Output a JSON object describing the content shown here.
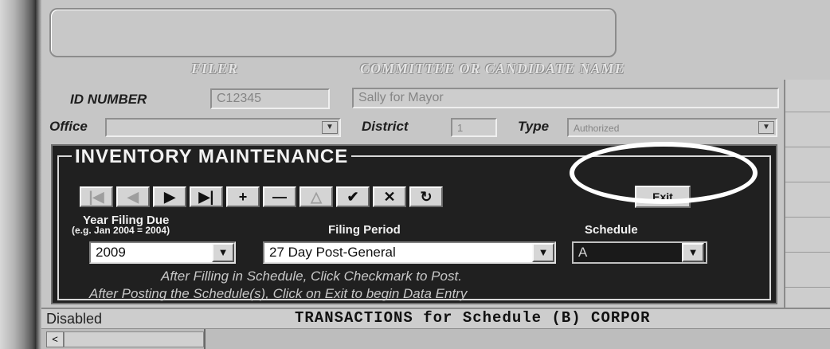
{
  "header": {
    "filer": "FILER",
    "committee_name_label": "COMMITTEE OR CANDIDATE NAME"
  },
  "form": {
    "id_number_label": "ID NUMBER",
    "id_number_value": "C12345",
    "committee_name_value": "Sally for Mayor",
    "office_label": "Office",
    "office_value": "",
    "district_label": "District",
    "district_value": "1",
    "type_label": "Type",
    "type_value": "Authorized"
  },
  "panel": {
    "title": "INVENTORY MAINTENANCE",
    "nav_buttons": [
      {
        "name": "first-record",
        "glyph": "|◀",
        "enabled": false
      },
      {
        "name": "previous-record",
        "glyph": "◀",
        "enabled": false
      },
      {
        "name": "next-record",
        "glyph": "▶",
        "enabled": true
      },
      {
        "name": "last-record",
        "glyph": "▶|",
        "enabled": true
      },
      {
        "name": "add-record",
        "glyph": "+",
        "enabled": true
      },
      {
        "name": "delete-record",
        "glyph": "—",
        "enabled": true
      },
      {
        "name": "edit-record",
        "glyph": "△",
        "enabled": false
      },
      {
        "name": "post-checkmark",
        "glyph": "✔",
        "enabled": true
      },
      {
        "name": "cancel",
        "glyph": "✕",
        "enabled": true
      },
      {
        "name": "refresh",
        "glyph": "↻",
        "enabled": true
      }
    ],
    "exit_label": "Exit",
    "year_label": "Year Filing Due",
    "year_hint": "(e.g. Jan 2004 = 2004)",
    "filing_period_label": "Filing Period",
    "schedule_label": "Schedule",
    "year_value": "2009",
    "filing_period_value": "27 Day Post-General",
    "schedule_value": "A",
    "instruction_1": "After Filling in Schedule, Click Checkmark to Post.",
    "instruction_2": "After Posting the Schedule(s), Click on Exit to begin Data Entry"
  },
  "status": {
    "left": "Disabled",
    "middle": "TRANSACTIONS for Schedule (B) CORPOR"
  },
  "scroll": {
    "left_arrow": "<"
  },
  "colors": {
    "panel_bg": "#202020",
    "window_bg": "#c6c6c6",
    "highlight_circle": "#ffffff"
  }
}
